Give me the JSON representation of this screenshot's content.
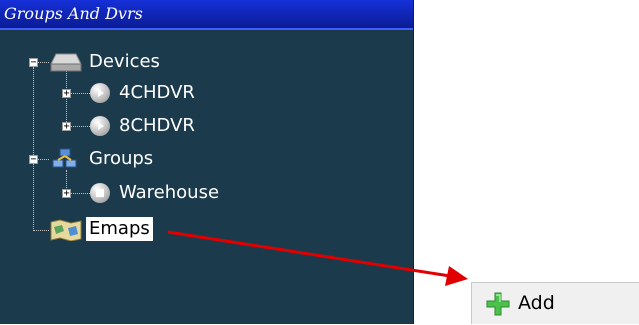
{
  "panel": {
    "title": "Groups And Dvrs",
    "tree": {
      "devices": {
        "label": "Devices",
        "toggle": "−"
      },
      "dvr1": {
        "label": "4CHDVR",
        "toggle": "+"
      },
      "dvr2": {
        "label": "8CHDVR",
        "toggle": "+"
      },
      "groups": {
        "label": "Groups",
        "toggle": "−"
      },
      "warehouse": {
        "label": "Warehouse",
        "toggle": "+"
      },
      "emaps": {
        "label": "Emaps"
      }
    }
  },
  "context_menu": {
    "add_label": "Add"
  },
  "colors": {
    "panel_bg": "#1b3b4c",
    "title_bg": "#0a1a8f",
    "arrow": "#e00000",
    "add_icon": "#3cb83c"
  }
}
